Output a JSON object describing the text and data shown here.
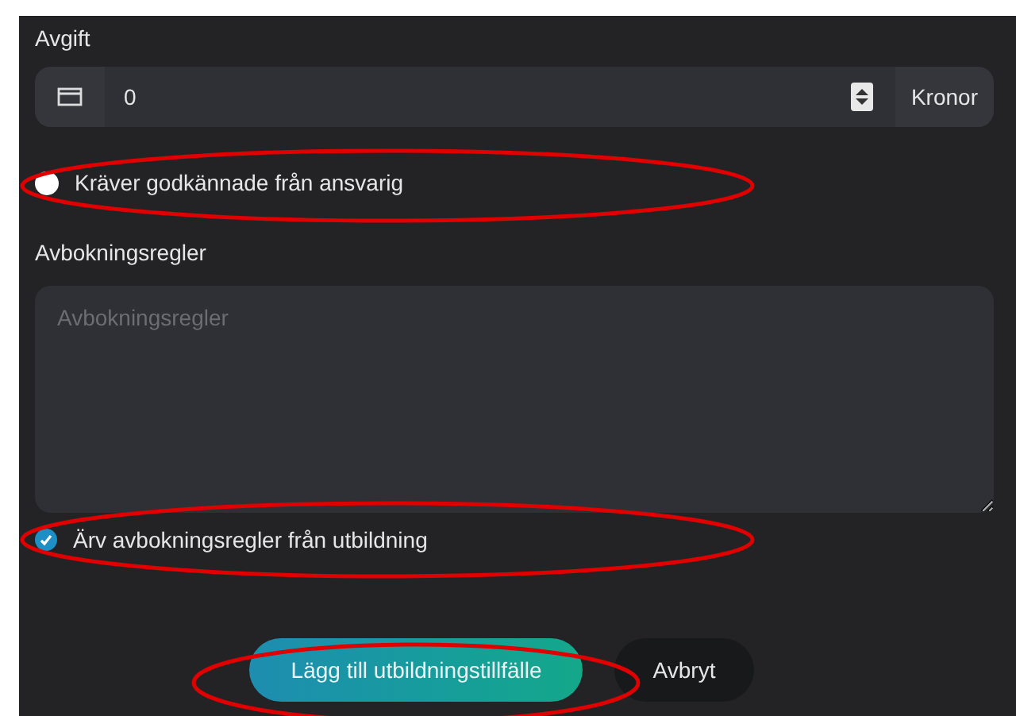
{
  "fee": {
    "label": "Avgift",
    "value": "0",
    "unit": "Kronor"
  },
  "approval": {
    "label": "Kräver godkännade från ansvarig",
    "on": false
  },
  "cancellation": {
    "label": "Avbokningsregler",
    "placeholder": "Avbokningsregler"
  },
  "inherit": {
    "label": "Ärv avbokningsregler från utbildning",
    "checked": true
  },
  "buttons": [
    {
      "label": "Lägg till utbildningstillfälle",
      "kind": "primary"
    },
    {
      "label": "Avbryt",
      "kind": "secondary"
    }
  ]
}
